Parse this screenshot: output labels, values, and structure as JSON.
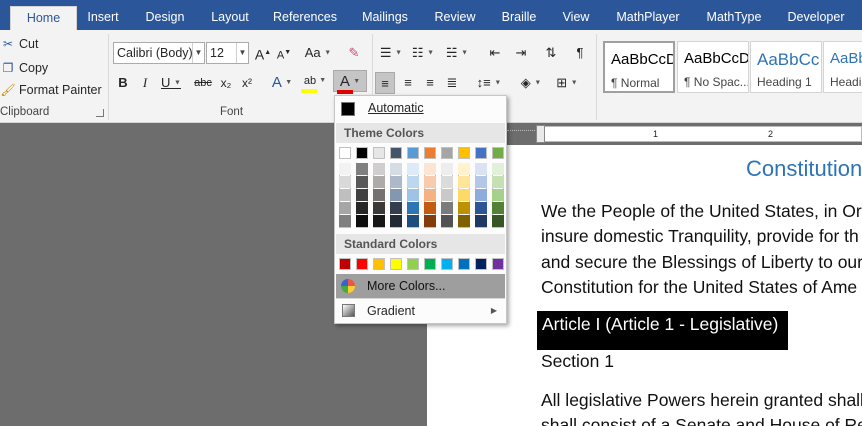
{
  "tabs": [
    "Home",
    "Insert",
    "Design",
    "Layout",
    "References",
    "Mailings",
    "Review",
    "Braille",
    "View",
    "MathPlayer",
    "MathType",
    "Developer"
  ],
  "active_tab": "Home",
  "clipboard": {
    "cut": "Cut",
    "copy": "Copy",
    "format_painter": "Format Painter",
    "group_label": "Clipboard"
  },
  "font": {
    "font_name": "Calibri (Body)",
    "font_size": "12",
    "grow_label": "A",
    "shrink_label": "A",
    "change_case_label": "Aa",
    "bold_label": "B",
    "italic_label": "I",
    "underline_label": "U",
    "strike_label": "abc",
    "subscript_label": "x₂",
    "superscript_label": "x²",
    "text_effects_label": "A",
    "highlight_label": "ab",
    "font_color_label": "A",
    "group_label": "Font",
    "font_color_bar": "#e00000",
    "highlight_color_bar": "#ffff00"
  },
  "paragraph": {
    "pilcrow_label": "¶"
  },
  "styles": [
    {
      "sample": "AaBbCcD",
      "name": "¶ Normal",
      "color": "#000000",
      "selected": true
    },
    {
      "sample": "AaBbCcD",
      "name": "¶ No Spac...",
      "color": "#000000",
      "selected": false
    },
    {
      "sample": "AaBbCc",
      "name": "Heading 1",
      "color": "#2e74b5",
      "selected": false
    },
    {
      "sample": "AaBbC",
      "name": "Headi",
      "color": "#2e74b5",
      "selected": false
    }
  ],
  "color_menu": {
    "automatic": "Automatic",
    "theme_colors": "Theme Colors",
    "standard_colors": "Standard Colors",
    "more_colors": "More Colors...",
    "gradient": "Gradient",
    "theme_row": [
      "#ffffff",
      "#000000",
      "#e7e6e6",
      "#44546a",
      "#5b9bd5",
      "#ed7d31",
      "#a5a5a5",
      "#ffc000",
      "#4472c4",
      "#70ad47"
    ],
    "theme_shades": [
      [
        "#f2f2f2",
        "#d9d9d9",
        "#bfbfbf",
        "#a6a6a6",
        "#808080"
      ],
      [
        "#808080",
        "#595959",
        "#404040",
        "#262626",
        "#0d0d0d"
      ],
      [
        "#d0cece",
        "#aeaaaa",
        "#767171",
        "#3a3838",
        "#171616"
      ],
      [
        "#d6dce4",
        "#adb9ca",
        "#8497b0",
        "#333f4f",
        "#222a35"
      ],
      [
        "#deebf6",
        "#bdd7ee",
        "#9dc3e6",
        "#2e75b5",
        "#1e4e79"
      ],
      [
        "#fbe5d5",
        "#f7cbac",
        "#f4b183",
        "#c55a11",
        "#833c0b"
      ],
      [
        "#ededed",
        "#dbdbdb",
        "#c9c9c9",
        "#7b7b7b",
        "#525252"
      ],
      [
        "#fff2cc",
        "#fee599",
        "#ffd965",
        "#bf9000",
        "#7f6000"
      ],
      [
        "#dae3f3",
        "#b4c7e7",
        "#8faadc",
        "#2f5496",
        "#1f3864"
      ],
      [
        "#e2efd9",
        "#c5e0b3",
        "#a8d08d",
        "#538135",
        "#375623"
      ]
    ],
    "standard_row": [
      "#c00000",
      "#ff0000",
      "#ffc000",
      "#ffff00",
      "#92d050",
      "#00b050",
      "#00b0f0",
      "#0070c0",
      "#002060",
      "#7030a0"
    ]
  },
  "ruler": {
    "mark_1": "1",
    "mark_2": "2"
  },
  "document": {
    "title": "Constitution",
    "p1_line1": "We the People of the United States, in Or",
    "p1_line2": "insure domestic Tranquility, provide for th",
    "p1_line3": "and secure the Blessings of Liberty to our",
    "p1_line4": "Constitution for the United States of Ame",
    "article_heading": "Article I (Article 1 - Legislative)",
    "section": "Section 1",
    "p2_line1": "All legislative Powers herein granted shall",
    "p2_line2": "shall consist of a Senate and House of Rep"
  }
}
